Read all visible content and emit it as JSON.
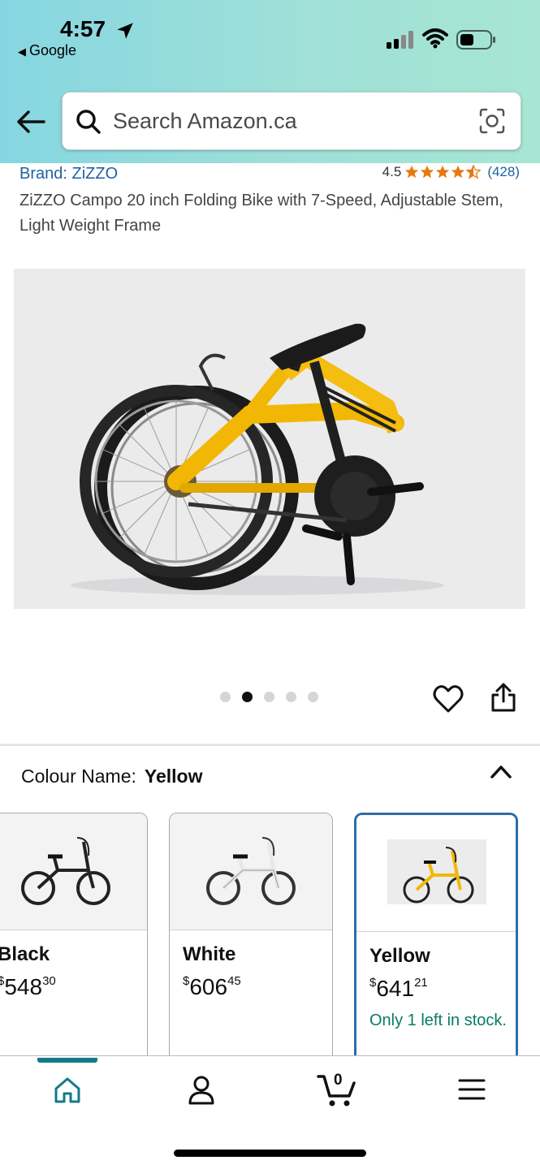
{
  "status_bar": {
    "time": "4:57",
    "back_app": "Google"
  },
  "search": {
    "placeholder": "Search Amazon.ca"
  },
  "product": {
    "brand": "Brand: ZiZZO",
    "rating": "4.5",
    "rating_value": 4.5,
    "rating_max": 5,
    "rating_count": "(428)",
    "title": "ZiZZO Campo 20 inch Folding Bike with 7-Speed, Adjustable Stem, Light Weight Frame"
  },
  "gallery": {
    "image_count": 5,
    "active_index": 1
  },
  "colour": {
    "label": "Colour Name:",
    "selected": "Yellow",
    "options": [
      {
        "name": "Black",
        "price_main": "548",
        "price_cents": "30",
        "currency": "$",
        "stock": ""
      },
      {
        "name": "White",
        "price_main": "606",
        "price_cents": "45",
        "currency": "$",
        "stock": ""
      },
      {
        "name": "Yellow",
        "price_main": "641",
        "price_cents": "21",
        "currency": "$",
        "stock": "Only 1 left in stock."
      }
    ]
  },
  "tabbar": {
    "cart_count": "0",
    "items": [
      "home-icon",
      "account-icon",
      "cart-icon",
      "menu-icon"
    ],
    "active": "home-icon"
  },
  "colors": {
    "link_blue": "#2162a1",
    "star_orange": "#e47911",
    "stock_green": "#067d62",
    "selected_border": "#2d6da6",
    "tab_active": "#137a8a"
  }
}
